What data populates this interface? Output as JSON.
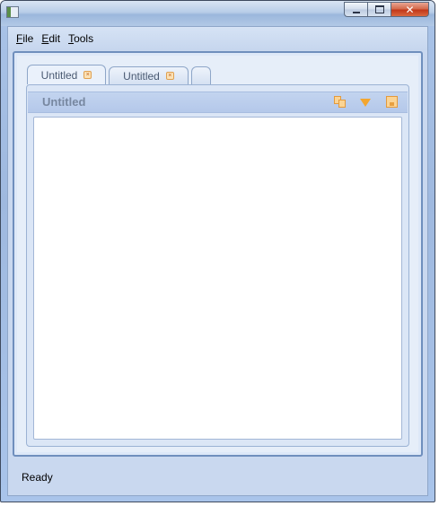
{
  "window": {
    "title": ""
  },
  "menu": {
    "items": [
      {
        "label": "File",
        "mnemonic": "F",
        "rest": "ile"
      },
      {
        "label": "Edit",
        "mnemonic": "E",
        "rest": "dit"
      },
      {
        "label": "Tools",
        "mnemonic": "T",
        "rest": "ools"
      }
    ]
  },
  "tabs": [
    {
      "label": "Untitled",
      "active": true,
      "close_icon": "close-icon"
    },
    {
      "label": "Untitled",
      "active": false,
      "close_icon": "close-icon"
    },
    {
      "label": "",
      "active": false
    }
  ],
  "document": {
    "title": "Untitled",
    "tools": [
      "copy-icon",
      "dropdown-arrow-icon",
      "save-icon"
    ],
    "content": ""
  },
  "status": {
    "text": "Ready"
  },
  "colors": {
    "accent_orange": "#f3a630",
    "frame_blue": "#6f8fbd",
    "client_bg": "#c9d8ef",
    "close_red": "#c2391a"
  }
}
